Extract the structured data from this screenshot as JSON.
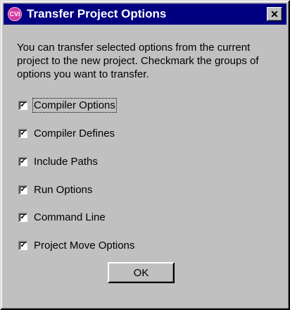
{
  "window": {
    "title": "Transfer Project Options",
    "app_icon": "cvi-logo-icon",
    "app_icon_text": "CVI",
    "close_label": "✕"
  },
  "description": "You can transfer selected options from the current project to the new project.  Checkmark the groups of options you want to transfer.",
  "options": [
    {
      "label": "Compiler Options",
      "checked": true,
      "focused": true
    },
    {
      "label": "Compiler Defines",
      "checked": true
    },
    {
      "label": "Include Paths",
      "checked": true
    },
    {
      "label": "Run Options",
      "checked": true
    },
    {
      "label": "Command Line",
      "checked": true
    },
    {
      "label": "Project Move Options",
      "checked": true
    }
  ],
  "ok_label": "OK",
  "check_mark": "✓"
}
